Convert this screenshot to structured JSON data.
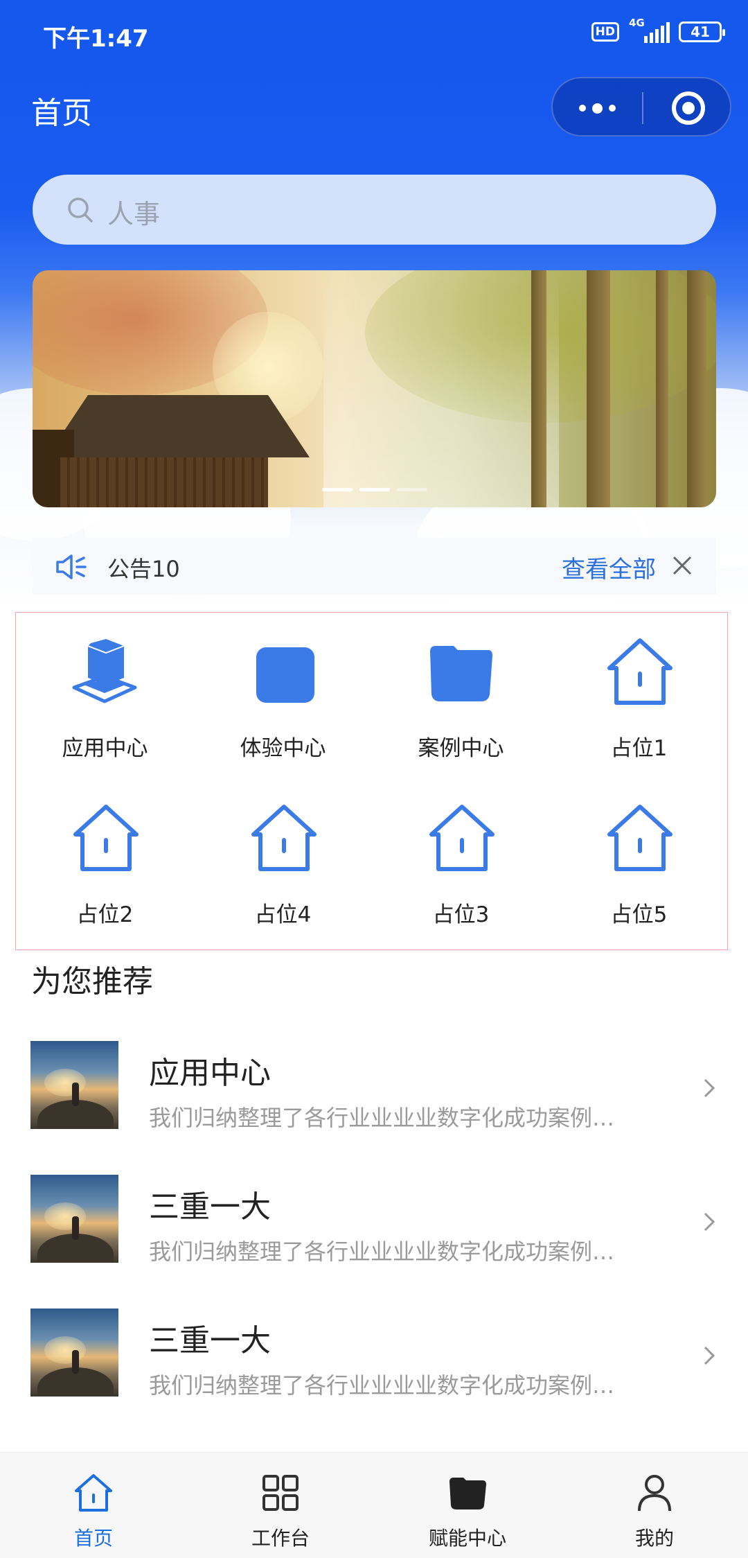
{
  "status_bar": {
    "time": "下午1:47",
    "hd": "HD",
    "network": "4G",
    "battery": "41"
  },
  "navbar": {
    "title": "首页",
    "more_icon": "more-dots-icon",
    "close_icon": "target-close-icon"
  },
  "search": {
    "placeholder": "人事",
    "icon": "search-icon"
  },
  "banner": {
    "slides": 3,
    "active_index": 1
  },
  "notice": {
    "icon": "speaker-icon",
    "text": "公告10",
    "view_all": "查看全部",
    "close_icon": "close-icon"
  },
  "grid": {
    "items": [
      {
        "label": "应用中心",
        "icon": "app-center-icon"
      },
      {
        "label": "体验中心",
        "icon": "experience-icon"
      },
      {
        "label": "案例中心",
        "icon": "case-icon"
      },
      {
        "label": "占位1",
        "icon": "home-icon"
      },
      {
        "label": "占位2",
        "icon": "home-icon"
      },
      {
        "label": "占位4",
        "icon": "home-icon"
      },
      {
        "label": "占位3",
        "icon": "home-icon"
      },
      {
        "label": "占位5",
        "icon": "home-icon"
      }
    ]
  },
  "recommend": {
    "title": "为您推荐",
    "items": [
      {
        "title": "应用中心",
        "desc": "我们归纳整理了各行业业业业数字化成功案例…"
      },
      {
        "title": "三重一大",
        "desc": "我们归纳整理了各行业业业业数字化成功案例…"
      },
      {
        "title": "三重一大",
        "desc": "我们归纳整理了各行业业业业数字化成功案例…"
      }
    ]
  },
  "tabbar": {
    "items": [
      {
        "label": "首页",
        "icon": "home-icon",
        "active": true
      },
      {
        "label": "工作台",
        "icon": "grid-icon",
        "active": false
      },
      {
        "label": "赋能中心",
        "icon": "folder-icon",
        "active": false
      },
      {
        "label": "我的",
        "icon": "user-icon",
        "active": false
      }
    ]
  },
  "colors": {
    "primary": "#1457ec",
    "accent_text": "#2a6fdb",
    "icon_blue": "#3b7be8",
    "highlight_border": "#f0a3a8"
  }
}
